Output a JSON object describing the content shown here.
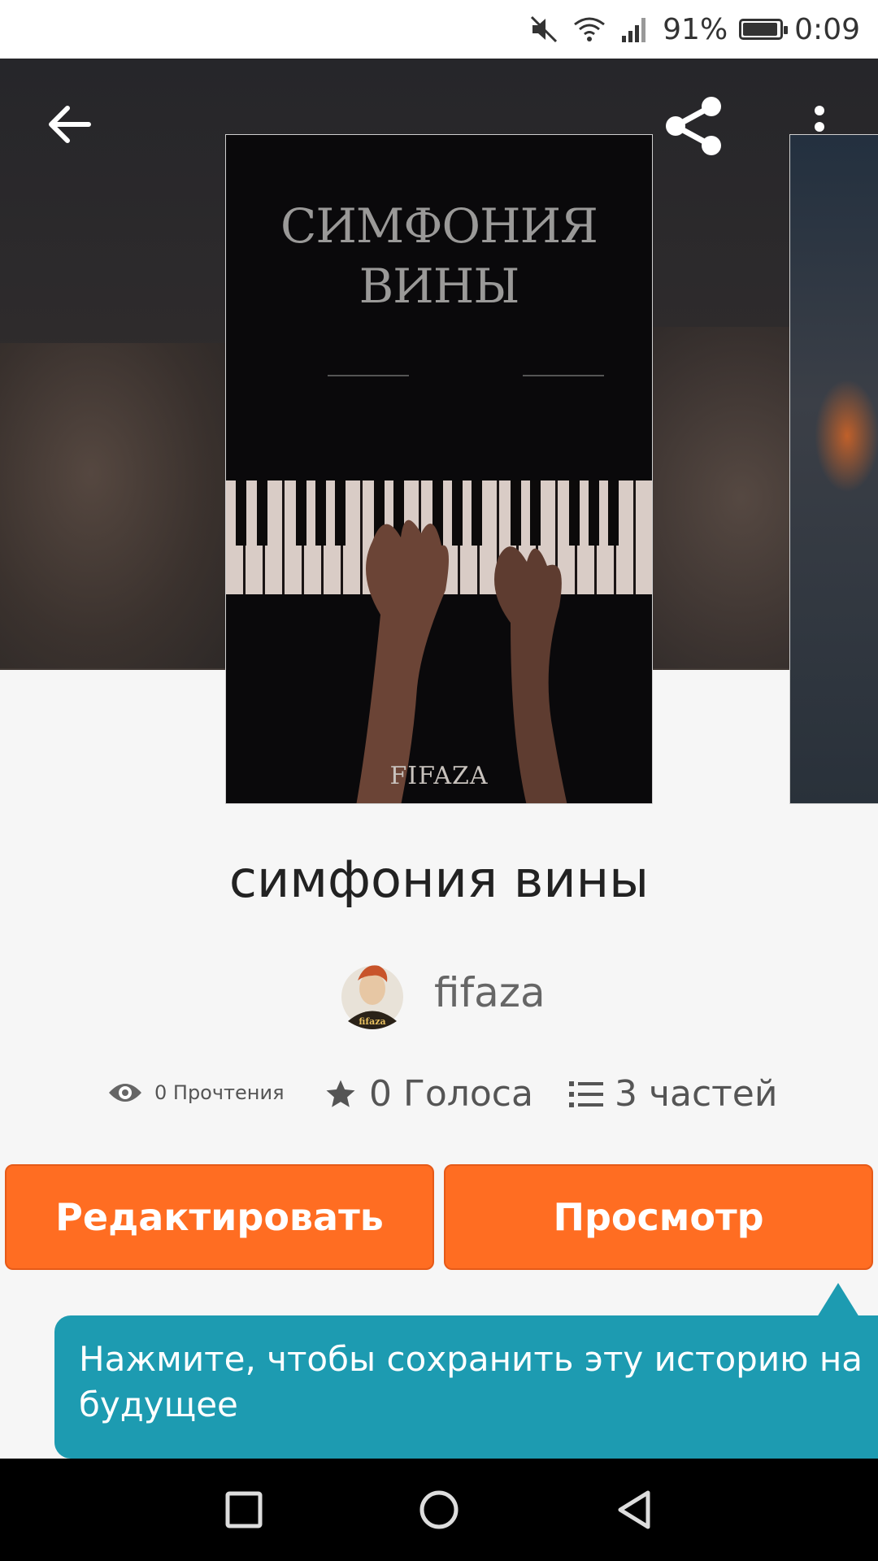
{
  "status_bar": {
    "battery_percent": "91%",
    "time": "0:09",
    "icons": [
      "mute-icon",
      "wifi-icon",
      "signal-icon",
      "battery-icon"
    ]
  },
  "toolbar": {
    "back_icon": "back-arrow-icon",
    "share_icon": "share-icon",
    "more_icon": "more-vertical-icon"
  },
  "cover": {
    "title_line1": "СИМФОНИЯ",
    "title_line2": "ВИНЫ",
    "author": "FIFAZA"
  },
  "story": {
    "title": "симфония вины",
    "author": "fifaza",
    "avatar_caption": "fifaza"
  },
  "stats": {
    "reads": "0 Прочтения",
    "votes": "0 Голоса",
    "parts": "3 частей"
  },
  "buttons": {
    "edit": "Редактировать",
    "view": "Просмотр"
  },
  "tooltip": {
    "text": "Нажмите, чтобы сохранить эту историю на будущее"
  },
  "colors": {
    "accent": "#ff6d22",
    "tooltip": "#1d9bb1",
    "header": "#2a2829"
  }
}
